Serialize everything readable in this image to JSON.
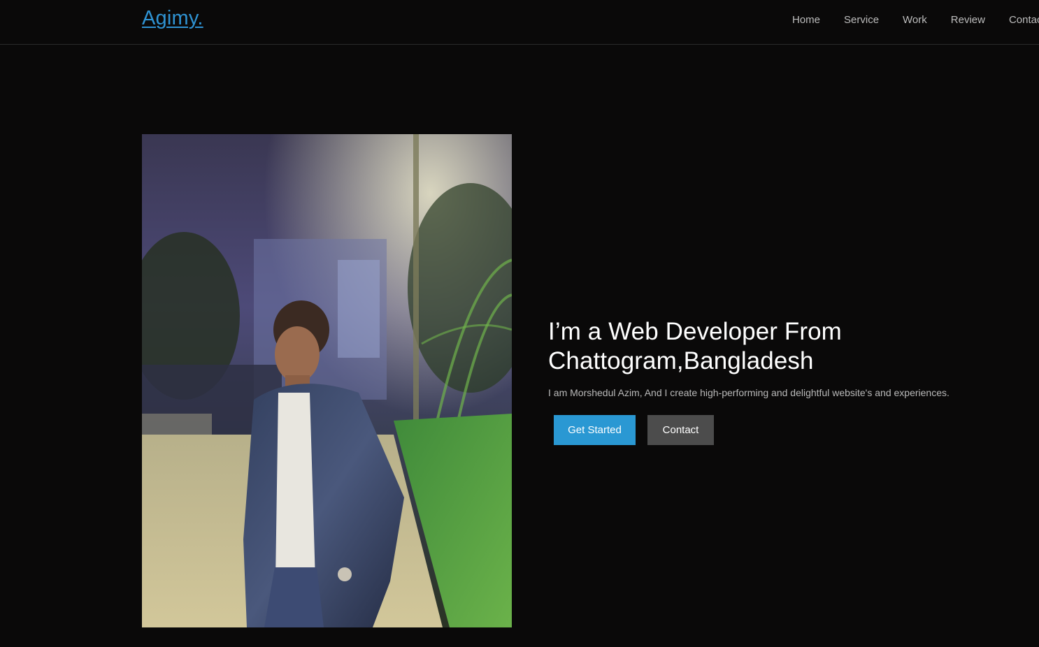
{
  "brand": {
    "logo_text": "Agimy.",
    "accent_color": "#2f93d3"
  },
  "nav": {
    "items": [
      {
        "label": "Home"
      },
      {
        "label": "Service"
      },
      {
        "label": "Work"
      },
      {
        "label": "Review"
      },
      {
        "label": "Contact"
      }
    ]
  },
  "hero": {
    "headline_line1": "I’m a Web Developer From",
    "headline_line2": "Chattogram,Bangladesh",
    "subtext": "I am Morshedul Azim, And I create high-performing and delightful website's and experiences.",
    "primary_button": {
      "label": "Get Started",
      "color": "#2a98d3"
    },
    "secondary_button": {
      "label": "Contact",
      "color": "#4c4c4c"
    }
  },
  "colors": {
    "background": "#0a0909",
    "text": "#ffffff",
    "muted_text": "#b9b9b9"
  }
}
